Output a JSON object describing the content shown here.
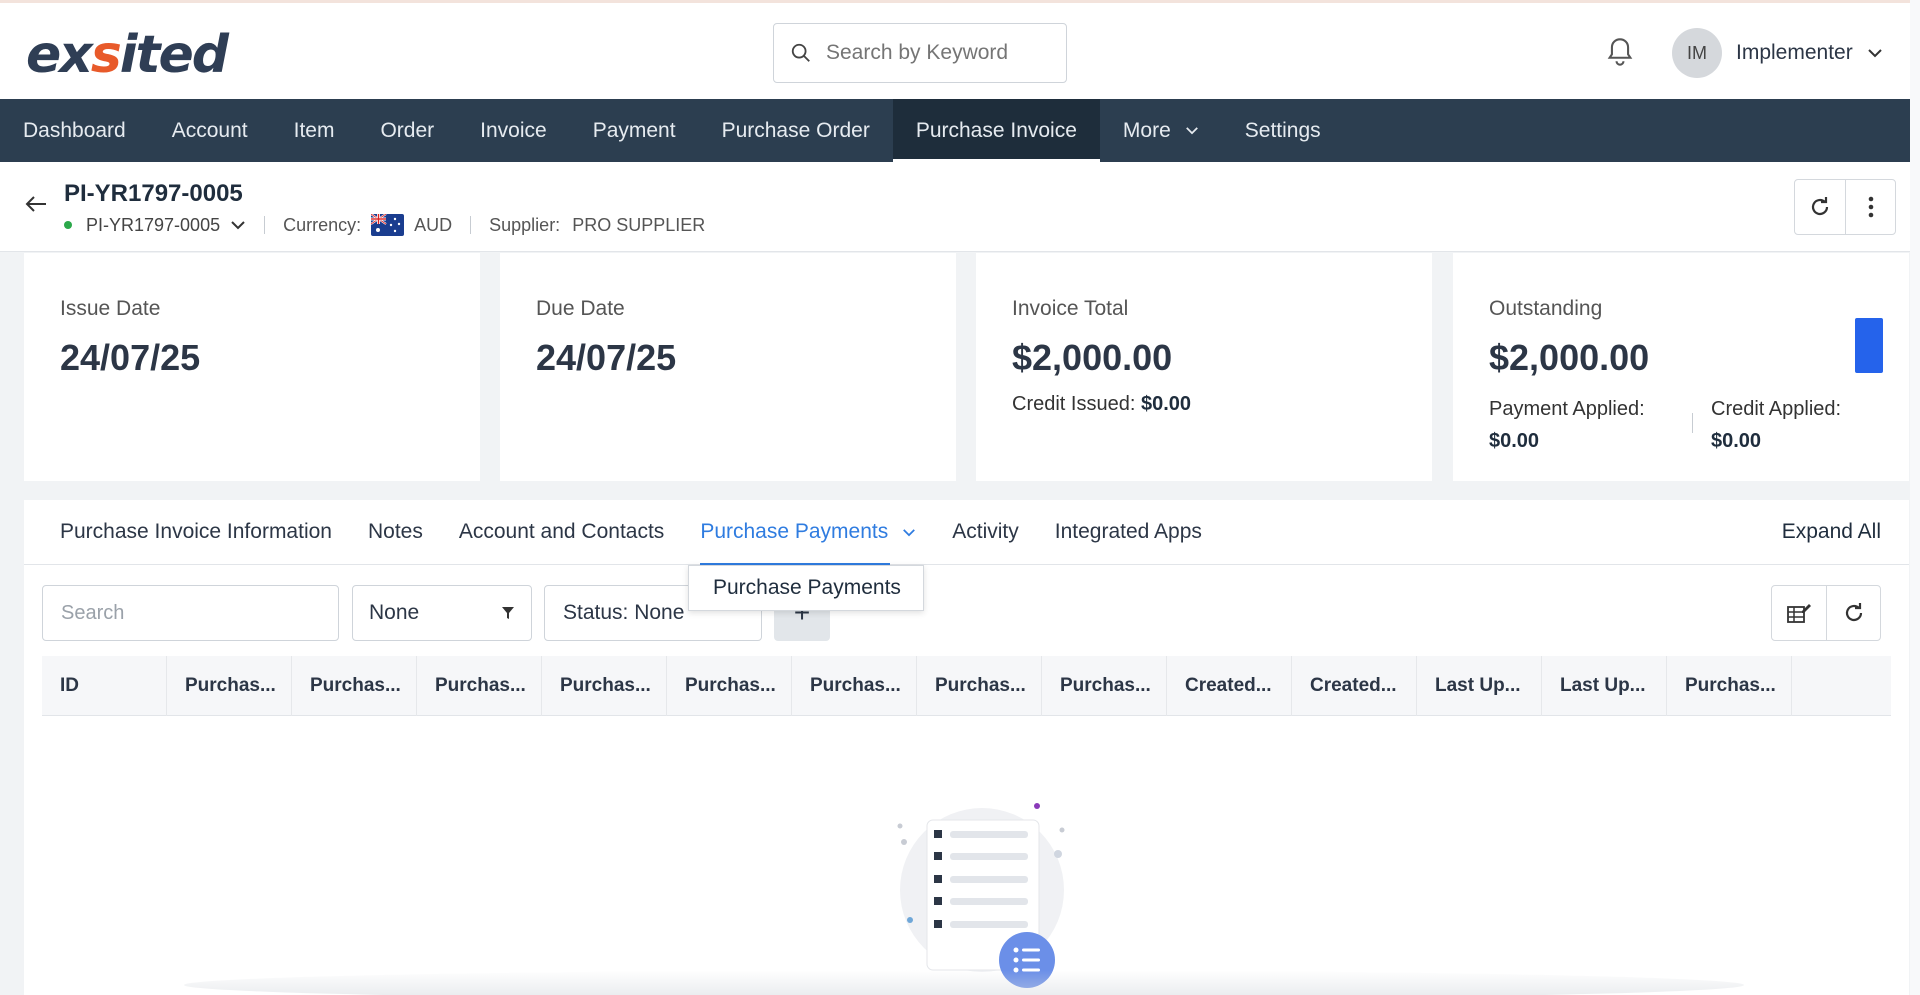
{
  "brand": {
    "logo_text_a": "ex",
    "logo_text_b": "s",
    "logo_text_c": "ited"
  },
  "top": {
    "search_placeholder": "Search by Keyword",
    "user_initials": "IM",
    "user_name": "Implementer"
  },
  "nav": {
    "items": [
      "Dashboard",
      "Account",
      "Item",
      "Order",
      "Invoice",
      "Payment",
      "Purchase Order",
      "Purchase Invoice",
      "More",
      "Settings"
    ],
    "active": "Purchase Invoice"
  },
  "header": {
    "title": "PI-YR1797-0005",
    "record": "PI-YR1797-0005",
    "currency_label": "Currency:",
    "currency": "AUD",
    "supplier_label": "Supplier:",
    "supplier": "PRO SUPPLIER"
  },
  "cards": {
    "issue": {
      "label": "Issue Date",
      "value": "24/07/25"
    },
    "due": {
      "label": "Due Date",
      "value": "24/07/25"
    },
    "total": {
      "label": "Invoice Total",
      "value": "$2,000.00",
      "credit_label": "Credit Issued:",
      "credit_value": "$0.00"
    },
    "outstanding": {
      "label": "Outstanding",
      "value": "$2,000.00",
      "payment_label": "Payment Applied:",
      "payment_value": "$0.00",
      "credit_label": "Credit Applied:",
      "credit_value": "$0.00"
    }
  },
  "tabs": {
    "items": [
      "Purchase Invoice Information",
      "Notes",
      "Account and Contacts",
      "Purchase Payments",
      "Activity",
      "Integrated Apps"
    ],
    "active": "Purchase Payments",
    "expand_all": "Expand All",
    "dropdown_item": "Purchase Payments"
  },
  "toolbar": {
    "search_placeholder": "Search",
    "view_select": "None",
    "status_filter": "Status: None",
    "add": "+"
  },
  "table": {
    "columns": [
      "ID",
      "Purchas...",
      "Purchas...",
      "Purchas...",
      "Purchas...",
      "Purchas...",
      "Purchas...",
      "Purchas...",
      "Purchas...",
      "Created...",
      "Created...",
      "Last Up...",
      "Last Up...",
      "Purchas..."
    ]
  },
  "colors": {
    "nav_bg": "#2c3e50",
    "accent": "#2f7ce0",
    "brand_orange": "#e85a2a",
    "status_green": "#2ba84a"
  }
}
